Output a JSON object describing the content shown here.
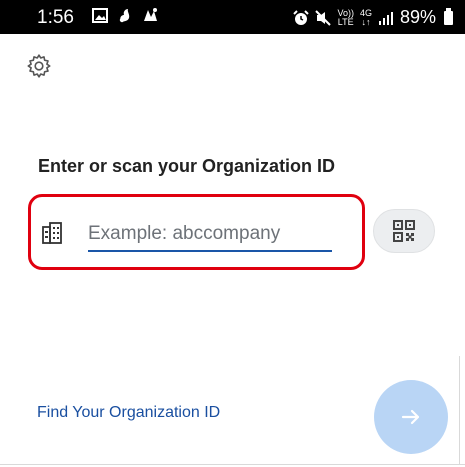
{
  "status_bar": {
    "time": "1:56",
    "left_icons": [
      "gallery-icon",
      "notification-icon",
      "app-notification-icon"
    ],
    "right_icons": [
      "alarm-icon",
      "mute-icon",
      "volte-icon",
      "4g-icon",
      "signal-icon"
    ],
    "volte_top": "Vo))",
    "volte_bottom": "LTE",
    "network_top": "4G",
    "network_bottom": "↓↑",
    "battery": "89%"
  },
  "form": {
    "heading": "Enter or scan your Organization ID",
    "placeholder": "Example: abccompany",
    "value": ""
  },
  "footer": {
    "link": "Find Your Organization ID"
  },
  "colors": {
    "highlight": "#e0000f",
    "accent": "#1a56a8",
    "link": "#1a4fa0",
    "next_button": "#b9d5f5"
  }
}
